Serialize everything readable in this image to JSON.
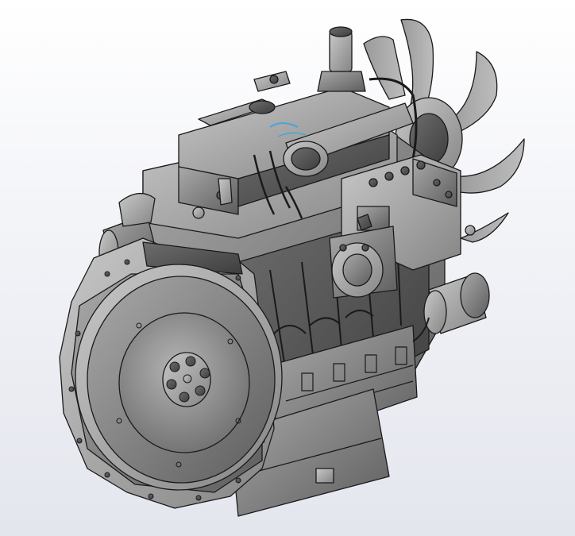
{
  "viewport": {
    "background_top": "#ffffff",
    "background_bottom": "#e4e6ee"
  },
  "model": {
    "icon": "engine-3d-model-icon",
    "shading": "shaded-with-edges",
    "body_color": "#8c8c8c",
    "edge_color": "#1a1a1a",
    "highlight_color": "#4aa3d8"
  }
}
